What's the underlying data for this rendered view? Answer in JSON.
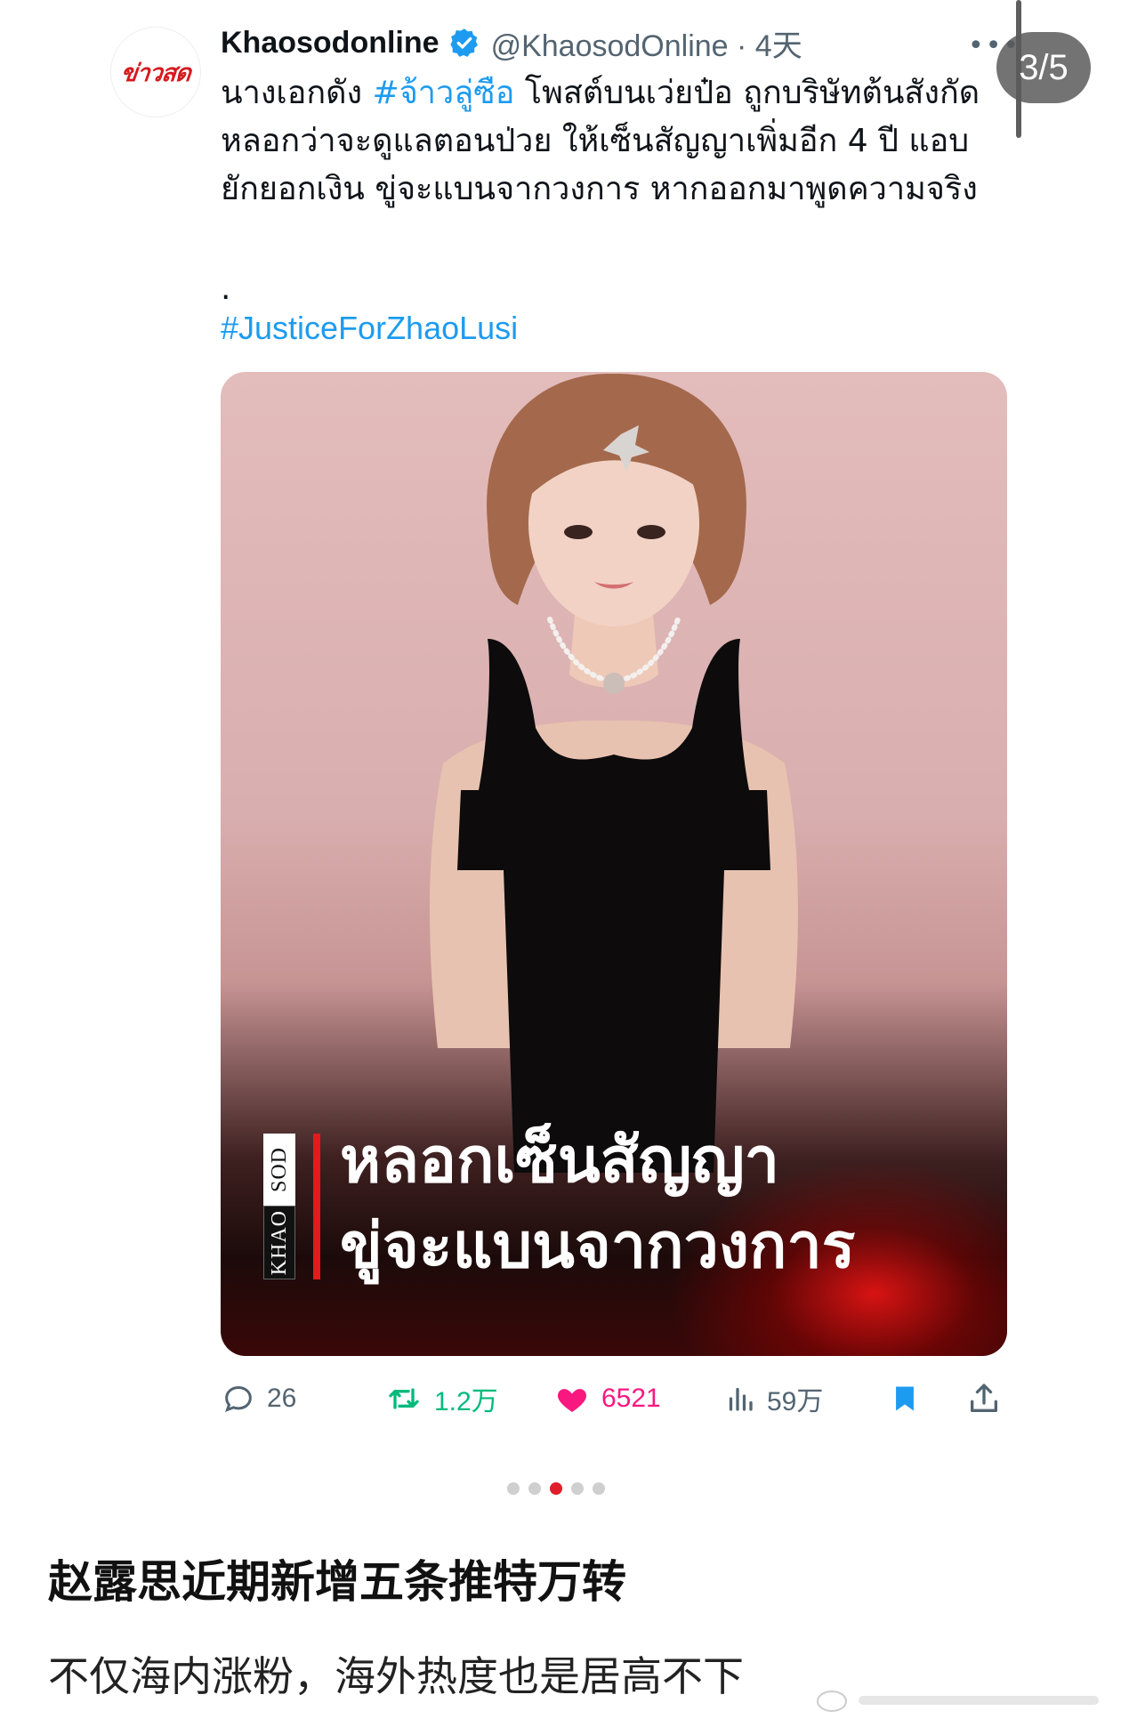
{
  "account": {
    "avatar_text": "ข่าวสด",
    "name": "Khaosodonline",
    "handle_time": "@KhaosodOnline · 4天"
  },
  "gallery": {
    "page_counter": "3/5",
    "dots_total": 5,
    "dots_active_index": 2
  },
  "tweet": {
    "body_prefix": "นางเอกดัง ",
    "body_hashtag": "#จ้าวลู่ซือ",
    "body_rest": " โพสต์บนเว่ยป๋อ ถูกบริษัทต้นสังกัดหลอกว่าจะดูแลตอนป่วย ให้เซ็นสัญญาเพิ่มอีก 4 ปี แอบยักยอกเงิน ขู่จะแบนจากวงการ หากออกมาพูดความจริง",
    "dot_line": ".",
    "hashtag2": "#JusticeForZhaoLusi"
  },
  "media": {
    "brand_top": "SOD",
    "brand_bottom": "KHAO",
    "headline_line1": "หลอกเซ็นสัญญา",
    "headline_line2": "ขู่จะแบนจากวงการ"
  },
  "actions": {
    "reply_count": "26",
    "retweet_count": "1.2万",
    "like_count": "6521",
    "views_count": "59万"
  },
  "post": {
    "title": "赵露思近期新增五条推特万转",
    "subtitle": "不仅海内涨粉，海外热度也是居高不下"
  },
  "colors": {
    "link": "#1d9bf0",
    "retweet": "#00ba7c",
    "like": "#f91880",
    "bookmark": "#1d9bf0",
    "brand_red": "#d51a1f"
  }
}
